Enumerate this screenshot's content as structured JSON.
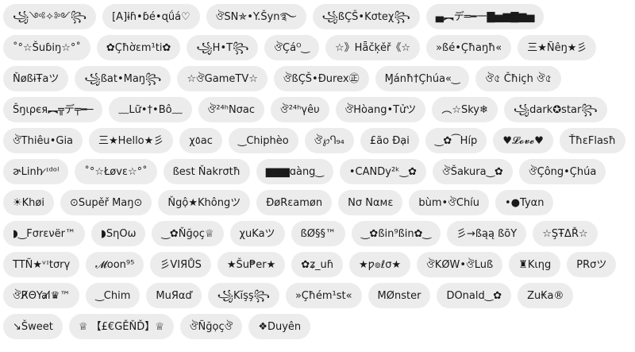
{
  "chips": [
    "꧁༺✧༻꧂",
    "[A]ɨɦ•ɓé•ɋǘá♡",
    "ঔSN✯•Y.Šyn࿐",
    "꧁ßÇŠ•Kσteχ꧂",
    "▄︻デ═━一▇▅▆▇▆▅",
    "˚°☆Šuɓiŋ☆°˚",
    "✿Çħờεm¹ti✿",
    "꧁H•T꧂",
    "ঔÇáᴼ‿",
    "☆》Hǟčķěř《☆",
    "»ßé•Çħaŋħ«",
    "三★Ñêŋ★彡",
    "ŇøßɨŦaツ",
    "꧁ßat•Maŋ꧂",
    "☆ঔGameTV☆",
    "ঔßÇŠ•Ðurex㊣",
    "Ɱánħ†Çhúa«‿",
    "ঔ৫ Čħiçh ঔ৫",
    "Šŋιρєя︻╦デ╤━─",
    "﹏Lữ•†•Bô﹏",
    "ঔ²⁴ʰΝσac",
    "ঔ²⁴ʰγêυ",
    "ঔHòang•Tửツ",
    "︵☆Sky❄",
    "꧁dark✪star꧂",
    "ঔThiêu•Gia",
    "三★Hello★彡",
    "χ٥ac",
    "‿Chiphèo",
    "ঔ℘Ⴄ₉₄",
    "£ão Đại",
    "‿✿⁀Híp",
    "♥𝓛𝓸𝓿𝓮♥",
    "ŤħεFlasħ",
    "ɚLinh ̷ᶦᵈᵒˡ",
    "˚°☆Łøvε☆°˚",
    "ßest Ňakrσtħ",
    "▆▆▆ɑàng‿",
    "•CANDy²ᵏ‿✿",
    "ঔŠakura‿✿",
    "ঔÇông•Çhúa",
    "☀Khøi",
    "⊙Supěř Maŋ⊙",
    "Ňgộ★Khôngツ",
    "ĐøRεamøn",
    "Nσ Nαмε",
    "bùm•ঔChíu",
    "•●Tyαn",
    "◗‿Fσrενër™",
    "◗SηOω",
    "‿✿Ňğọç♕",
    "χuKaツ",
    "ßØ§§™",
    "‿✿ßin⁹ßin✿‿",
    "彡→ßąą ßōΥ",
    "☆ŞŦΔŘ☆",
    "TTÑ★ᵛᶦtσrγ",
    "𝓜oon⁹⁵",
    "彡VIЯŮS",
    "★Šu₱er★",
    "✿ʑ_uɦ",
    "★ƿ๏ℓσ★",
    "ঔKØW•ঔLuß",
    "♜Kιηg",
    "PRσツ",
    "ঔR̸ΘYal̸♛™",
    "‿Chim",
    "MuЯαď",
    "꧁Kĭşş꧂",
    "»Çħém¹st«",
    "MØnster",
    "DOnald‿✿",
    "Zu₭a®",
    "↘Šweet",
    "♕ 【£€GĚŇĎ】♕",
    "ঔÑğọçঔ",
    "❖Duyên"
  ]
}
